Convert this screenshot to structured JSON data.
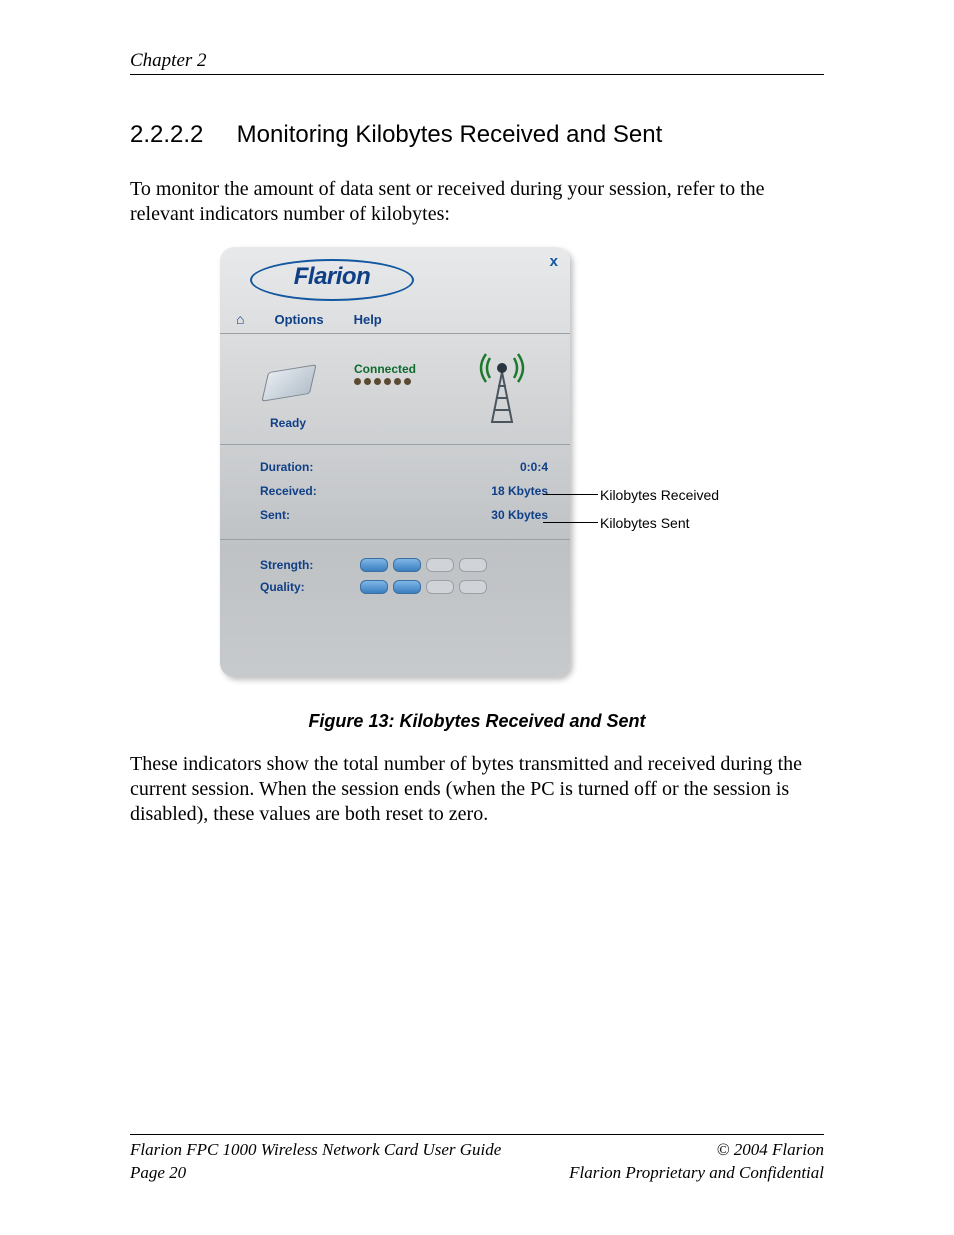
{
  "header": {
    "chapter": "Chapter 2"
  },
  "section": {
    "number": "2.2.2.2",
    "title": "Monitoring Kilobytes Received and Sent"
  },
  "intro_text": "To monitor the amount of data sent or received during your session, refer to the relevant indicators number of kilobytes:",
  "app": {
    "brand": "Flarion",
    "close_label": "x",
    "menu": {
      "options": "Options",
      "help": "Help"
    },
    "status": {
      "ready": "Ready",
      "connected": "Connected"
    },
    "rows": {
      "duration_label": "Duration:",
      "duration_value": "0:0:4",
      "received_label": "Received:",
      "received_value": "18 Kbytes",
      "sent_label": "Sent:",
      "sent_value": "30 Kbytes"
    },
    "signal": {
      "strength_label": "Strength:",
      "quality_label": "Quality:"
    }
  },
  "callouts": {
    "received": "Kilobytes Received",
    "sent": "Kilobytes Sent"
  },
  "figure_caption": "Figure 13: Kilobytes Received and Sent",
  "after_text": "These indicators show the total number of bytes transmitted and received during the current session. When the session ends (when the PC is turned off or the session is disabled), these values are both reset to zero.",
  "footer": {
    "left_line1": "Flarion FPC 1000 Wireless Network Card User Guide",
    "left_line2": "Page 20",
    "right_line1": "©  2004 Flarion",
    "right_line2": "Flarion Proprietary and Confidential"
  }
}
